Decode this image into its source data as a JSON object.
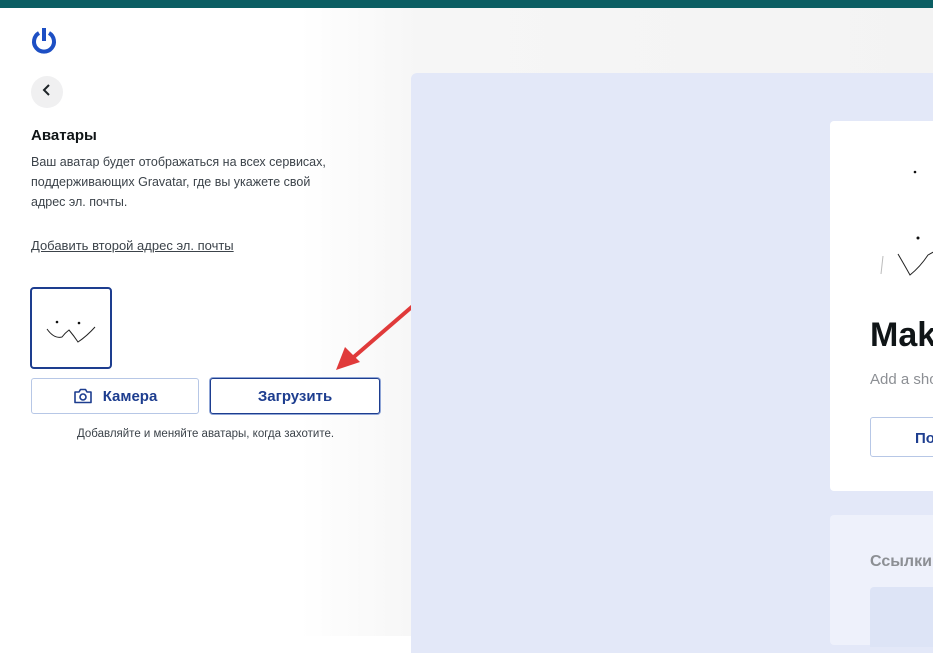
{
  "header": {
    "logo_icon": "gravatar-power-icon",
    "accent": "#0b5e63"
  },
  "nav": {
    "back_icon": "chevron-left-icon"
  },
  "avatars": {
    "title": "Аватары",
    "description": "Ваш аватар будет отображаться на всех сервисах, поддерживающих Gravatar, где вы укажете свой адрес эл. почты.",
    "add_email_link": "Добавить второй адрес эл. почты",
    "camera_label": "Камера",
    "upload_label": "Загрузить",
    "hint": "Добавляйте и меняйте аватары, когда захотите."
  },
  "preview": {
    "name_partial": "Mak",
    "subtitle_partial": "Add a sho",
    "button_partial": "По",
    "links_title_partial": "Ссылки",
    "background": "#e3e8f8"
  },
  "colors": {
    "primary": "#1d3d8f",
    "annotation_arrow": "#e03a3a"
  }
}
